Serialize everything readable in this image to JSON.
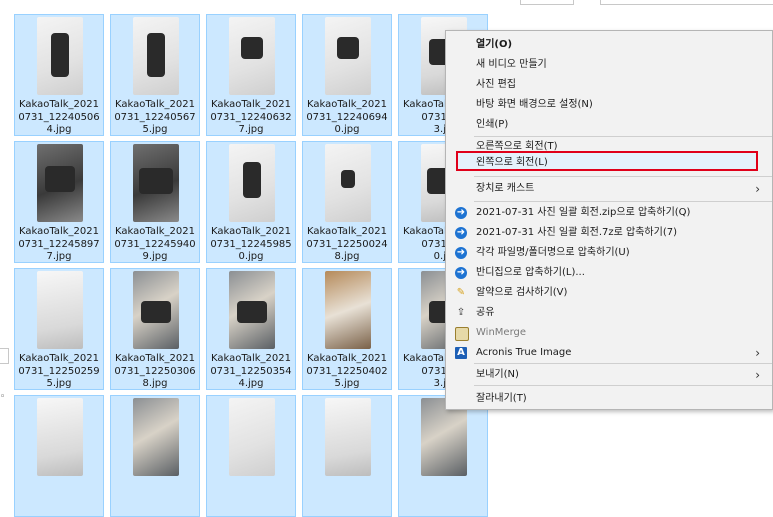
{
  "files": [
    {
      "name": "KakaoTalk_2021\n0731_12240506\n4.jpg",
      "thumb": "light",
      "obj": "cable"
    },
    {
      "name": "KakaoTalk_2021\n0731_12240567\n5.jpg",
      "thumb": "light",
      "obj": "cable"
    },
    {
      "name": "KakaoTalk_2021\n0731_12240632\n7.jpg",
      "thumb": "light",
      "obj": "gps"
    },
    {
      "name": "KakaoTalk_2021\n0731_12240694\n0.jpg",
      "thumb": "light",
      "obj": "gps"
    },
    {
      "name": "KakaoTalk_2021\n0731_12\n3.jp",
      "thumb": "box",
      "obj": "cam"
    },
    {
      "name": "KakaoTalk_2021\n0731_12245897\n7.jpg",
      "thumb": "dark",
      "obj": "cam"
    },
    {
      "name": "KakaoTalk_2021\n0731_12245940\n9.jpg",
      "thumb": "dark",
      "obj": "screen"
    },
    {
      "name": "KakaoTalk_2021\n0731_12245985\n0.jpg",
      "thumb": "light",
      "obj": "cyl"
    },
    {
      "name": "KakaoTalk_2021\n0731_12250024\n8.jpg",
      "thumb": "light",
      "obj": "small"
    },
    {
      "name": "KakaoTalk_2021\n0731_12\n0.jp",
      "thumb": "box",
      "obj": "screen"
    },
    {
      "name": "KakaoTalk_2021\n0731_12250259\n5.jpg",
      "thumb": "box",
      "obj": "none"
    },
    {
      "name": "KakaoTalk_2021\n0731_12250306\n8.jpg",
      "thumb": "mixed",
      "obj": "parts"
    },
    {
      "name": "KakaoTalk_2021\n0731_12250354\n4.jpg",
      "thumb": "mixed",
      "obj": "parts"
    },
    {
      "name": "KakaoTalk_2021\n0731_12250402\n5.jpg",
      "thumb": "wood",
      "obj": "none"
    },
    {
      "name": "KakaoTalk_2021\n0731_12\n3.jp",
      "thumb": "mixed",
      "obj": "parts"
    }
  ],
  "partial_thumbs": [
    "t-box",
    "t-mixed",
    "t-light"
  ],
  "menu": {
    "items": [
      {
        "label": "열기(O)",
        "bold": true
      },
      {
        "label": "새 비디오 만들기"
      },
      {
        "label": "사진 편집"
      },
      {
        "label": "바탕 화면 배경으로 설정(N)"
      },
      {
        "label": "인쇄(P)"
      },
      {
        "label": "오른쪽으로 회전(T)"
      },
      {
        "label": "왼쪽으로 회전(L)",
        "highlighted": true
      },
      {
        "label": "장치로 캐스트",
        "submenu": true
      },
      {
        "label": "2021-07-31 사진 일괄 회전.zip으로 압축하기(Q)",
        "icon": "bandizip-icon"
      },
      {
        "label": "2021-07-31 사진 일괄 회전.7z로 압축하기(7)",
        "icon": "bandizip-icon"
      },
      {
        "label": "각각 파일명/폴더명으로 압축하기(U)",
        "icon": "bandizip-icon"
      },
      {
        "label": "반디집으로 압축하기(L)...",
        "icon": "bandizip-icon"
      },
      {
        "label": "알약으로 검사하기(V)",
        "icon": "alyac-icon"
      },
      {
        "label": "공유",
        "icon": "share-icon"
      },
      {
        "label": "WinMerge",
        "icon": "winmerge-icon",
        "disabled": true
      },
      {
        "label": "Acronis True Image",
        "icon": "acronis-icon",
        "submenu": true
      },
      {
        "label": "보내기(N)",
        "submenu": true
      },
      {
        "label": "잘라내기(T)"
      }
    ]
  },
  "colors": {
    "selection_bg": "#cce8ff",
    "selection_border": "#99d1ff",
    "menu_bg": "#f2f2f2",
    "highlight_border": "#e0001a"
  }
}
